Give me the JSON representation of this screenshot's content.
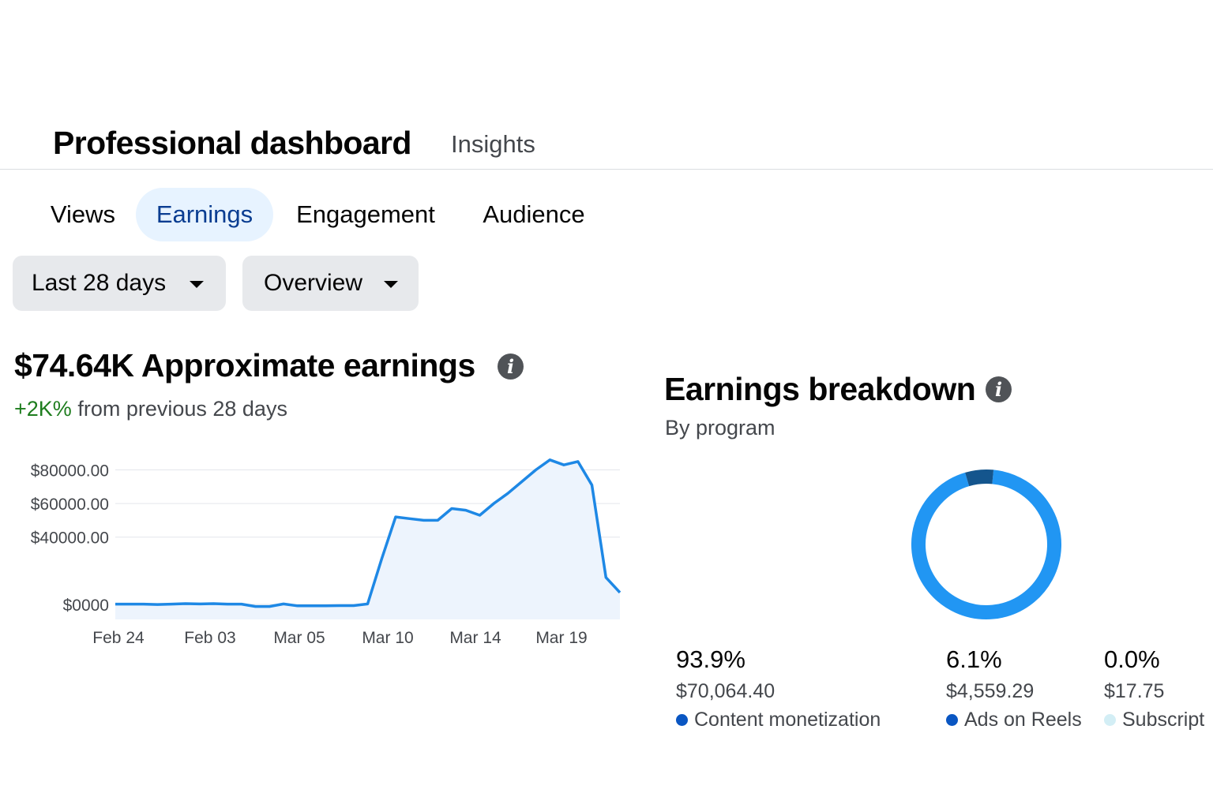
{
  "header": {
    "title": "Professional dashboard",
    "subtitle": "Insights"
  },
  "tabs": [
    {
      "label": "Views",
      "active": false
    },
    {
      "label": "Earnings",
      "active": true
    },
    {
      "label": "Engagement",
      "active": false
    },
    {
      "label": "Audience",
      "active": false
    }
  ],
  "filters": {
    "date_range": "Last 28 days",
    "view": "Overview"
  },
  "earnings": {
    "title": "$74.64K Approximate earnings",
    "change_value": "+2K%",
    "change_text": "from previous 28 days"
  },
  "chart_data": {
    "type": "area",
    "y_tick_labels": [
      "$80000.00",
      "$60000.00",
      "$40000.00",
      "$0000"
    ],
    "y_tick_values": [
      80000,
      60000,
      40000,
      0
    ],
    "x_tick_labels": [
      "Feb 24",
      "Feb 03",
      "Mar 05",
      "Mar 10",
      "Mar 14",
      "Mar 19"
    ],
    "ylim": [
      -9000,
      92000
    ],
    "grid": true,
    "series": [
      {
        "color": "#1e88e5",
        "fill": "#edf4fd",
        "values": [
          100,
          100,
          100,
          -100,
          100,
          400,
          200,
          400,
          100,
          100,
          -1300,
          -1300,
          200,
          -900,
          -900,
          -900,
          -800,
          -800,
          200,
          27000,
          52000,
          51000,
          50000,
          50000,
          57000,
          56000,
          53000,
          60000,
          66000,
          73000,
          80000,
          86000,
          83000,
          85000,
          71000,
          16000,
          7000
        ]
      }
    ]
  },
  "breakdown": {
    "title": "Earnings breakdown",
    "subtitle": "By program",
    "slices": [
      {
        "label": "Content monetization",
        "pct": "93.9%",
        "value": 93.9,
        "amount": "$70,064.40",
        "color": "#2196f3",
        "dot_color": "#0a56c2"
      },
      {
        "label": "Ads on Reels",
        "pct": "6.1%",
        "value": 6.1,
        "amount": "$4,559.29",
        "color": "#14558d",
        "dot_color": "#0a56c2"
      },
      {
        "label": "Subscript",
        "pct": "0.0%",
        "value": 0.0,
        "amount": "$17.75",
        "color": "#d3eef5",
        "dot_color": "#d3eef5"
      }
    ]
  },
  "icons": {
    "info": "info-icon",
    "caret": "caret-down-icon"
  }
}
